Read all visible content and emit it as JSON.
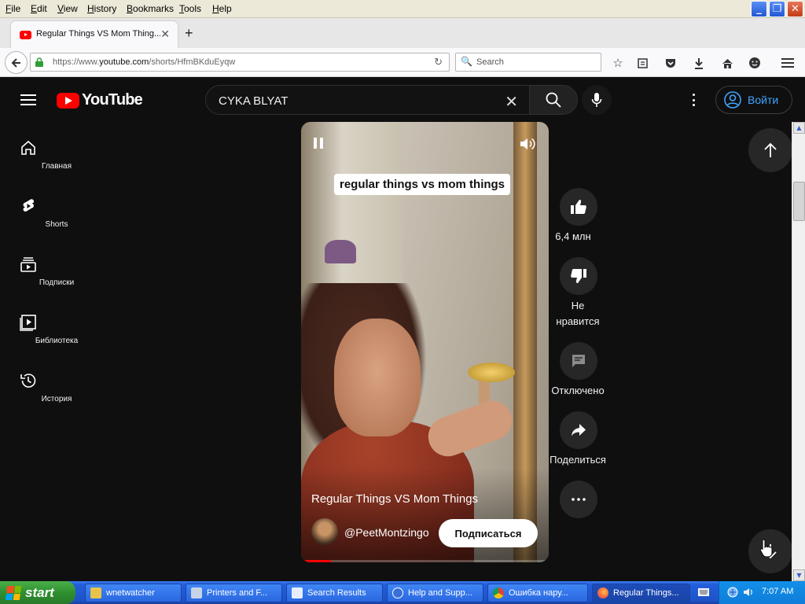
{
  "menu": {
    "items": [
      "File",
      "Edit",
      "View",
      "History",
      "Bookmarks",
      "Tools",
      "Help"
    ]
  },
  "window_controls": {
    "minimize": "_",
    "restore": "❐",
    "close": "✕"
  },
  "tab": {
    "title": "Regular Things VS Mom Thing..."
  },
  "address": {
    "url_prefix": "https://www.",
    "url_domain": "youtube.com",
    "url_path": "/shorts/HfmBKduEyqw",
    "search_placeholder": "Search"
  },
  "youtube": {
    "logo_text": "YouTube",
    "search_query": "CYKA BLYAT",
    "signin_label": "Войти",
    "sidebar": [
      {
        "label": "Главная",
        "icon": "home-icon"
      },
      {
        "label": "Shorts",
        "icon": "shorts-icon"
      },
      {
        "label": "Подписки",
        "icon": "subscriptions-icon"
      },
      {
        "label": "Библиотека",
        "icon": "library-icon"
      },
      {
        "label": "История",
        "icon": "history-icon"
      }
    ],
    "video": {
      "caption": "regular things vs mom things",
      "title": "Regular Things VS Mom Things",
      "channel": "@PeetMontzingo",
      "subscribe_label": "Подписаться",
      "progress_fraction": 0.12
    },
    "actions": {
      "like_count": "6,4 млн",
      "dislike_label_1": "Не",
      "dislike_label_2": "нравится",
      "comments_label": "Отключено",
      "share_label": "Поделиться"
    }
  },
  "taskbar": {
    "start_label": "start",
    "tasks": [
      "wnetwatcher",
      "Printers and F...",
      "Search Results",
      "Help and Supp...",
      "Ошибка нару...",
      "Regular Things..."
    ],
    "clock": "7:07 AM"
  },
  "colors": {
    "yt_red": "#ff0000",
    "yt_bg": "#0f0f0f",
    "signin_blue": "#3ea6ff",
    "xp_blue": "#245edb",
    "xp_green": "#3c9f3c"
  }
}
